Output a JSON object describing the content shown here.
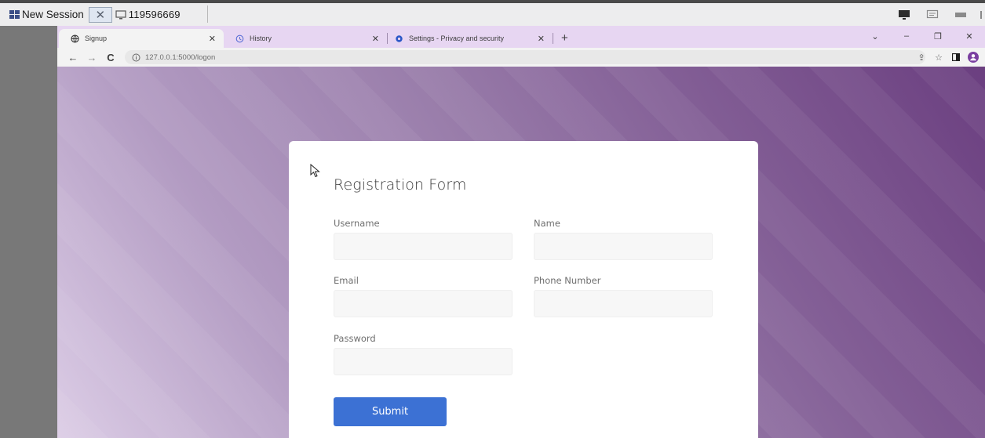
{
  "session": {
    "title": "New Session",
    "close_glyph": "✕",
    "connection_id": "119596669"
  },
  "tabs": [
    {
      "label": "Signup",
      "icon": "globe-icon",
      "close": "✕",
      "active": true
    },
    {
      "label": "History",
      "icon": "history-icon",
      "close": "✕",
      "active": false
    },
    {
      "label": "Settings - Privacy and security",
      "icon": "settings-icon",
      "close": "✕",
      "active": false
    }
  ],
  "new_tab_label": "+",
  "window_controls": {
    "dropdown": "⌄",
    "minimize": "–",
    "restore": "❐",
    "close": "✕"
  },
  "addressbar": {
    "back": "←",
    "forward": "→",
    "reload": "C",
    "url": "127.0.0.1:5000/logon",
    "share": "⇪",
    "bookmark": "☆"
  },
  "form": {
    "title": "Registration Form",
    "fields": {
      "username": {
        "label": "Username",
        "value": "",
        "placeholder": ""
      },
      "name": {
        "label": "Name",
        "value": "",
        "placeholder": ""
      },
      "email": {
        "label": "Email",
        "value": "",
        "placeholder": ""
      },
      "phone": {
        "label": "Phone Number",
        "value": "",
        "placeholder": ""
      },
      "password": {
        "label": "Password",
        "value": "",
        "placeholder": ""
      }
    },
    "submit_label": "Submit"
  },
  "colors": {
    "tabstrip": "#e7d6f2",
    "accent_button": "#3c71d4",
    "background_dark": "#6b3f80",
    "background_light": "#dccde6"
  }
}
